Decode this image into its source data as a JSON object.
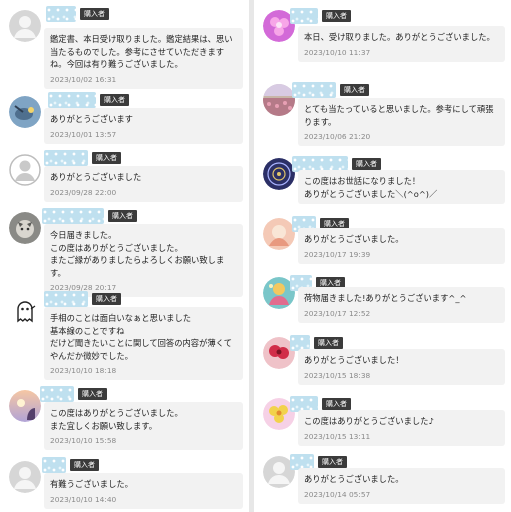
{
  "role_badge": "購入者",
  "left_reviews": [
    {
      "avatar": "default",
      "text": "鑑定書、本日受け取りました。鑑定結果は、思い当たるものでした。参考にさせていただきますね。今回は有り難うございました。",
      "date": "2023/10/02 16:31"
    },
    {
      "avatar": "bird",
      "text": "ありがとうございます",
      "date": "2023/10/01 13:57"
    },
    {
      "avatar": "default-outline",
      "text": "ありがとうございました",
      "date": "2023/09/28 22:00"
    },
    {
      "avatar": "cat",
      "text": "今日届きました。\nこの度はありがとうございました。\nまたご縁がありましたらよろしくお願い致します。",
      "date": "2023/09/28 20:17"
    },
    {
      "avatar": "ghost",
      "text": "手相のことは面白いなぁと思いました\n基本線のことですね\nだけど聞きたいことに関して回答の内容が薄くてやんだか微妙でした。",
      "date": "2023/10/10 18:18"
    },
    {
      "avatar": "sunset",
      "text": "この度はありがとうございました。\nまた宜しくお願い致します。",
      "date": "2023/10/10 15:58"
    },
    {
      "avatar": "default",
      "text": "有難うございました。",
      "date": "2023/10/10 14:40"
    }
  ],
  "right_reviews": [
    {
      "avatar": "pink-flower",
      "text": "本日、受け取りました。ありがとうございました。",
      "date": "2023/10/10 11:37"
    },
    {
      "avatar": "field",
      "text": "とても当たっていると思いました。参考にして頑張ります。",
      "date": "2023/10/06 21:20"
    },
    {
      "avatar": "mandala",
      "text": "この度はお世話になりました！\nありがとうございました＼(^o^)／",
      "date": ""
    },
    {
      "avatar": "peach",
      "text": "ありがとうございました。",
      "date": "2023/10/17 19:39"
    },
    {
      "avatar": "colorful",
      "text": "荷物届きました!ありがとうございます^_^",
      "date": "2023/10/17 12:52"
    },
    {
      "avatar": "red-flower",
      "text": "ありがとうございました！",
      "date": "2023/10/15 18:38"
    },
    {
      "avatar": "yellow-flower",
      "text": "この度はありがとうございました♪",
      "date": "2023/10/15 13:11"
    },
    {
      "avatar": "default",
      "text": "ありがとうございました。",
      "date": "2023/10/14 05:57"
    }
  ],
  "colors": {
    "bubble": "#f2f2f2",
    "badge": "#3b3b3b",
    "date": "#8a8a8a"
  }
}
